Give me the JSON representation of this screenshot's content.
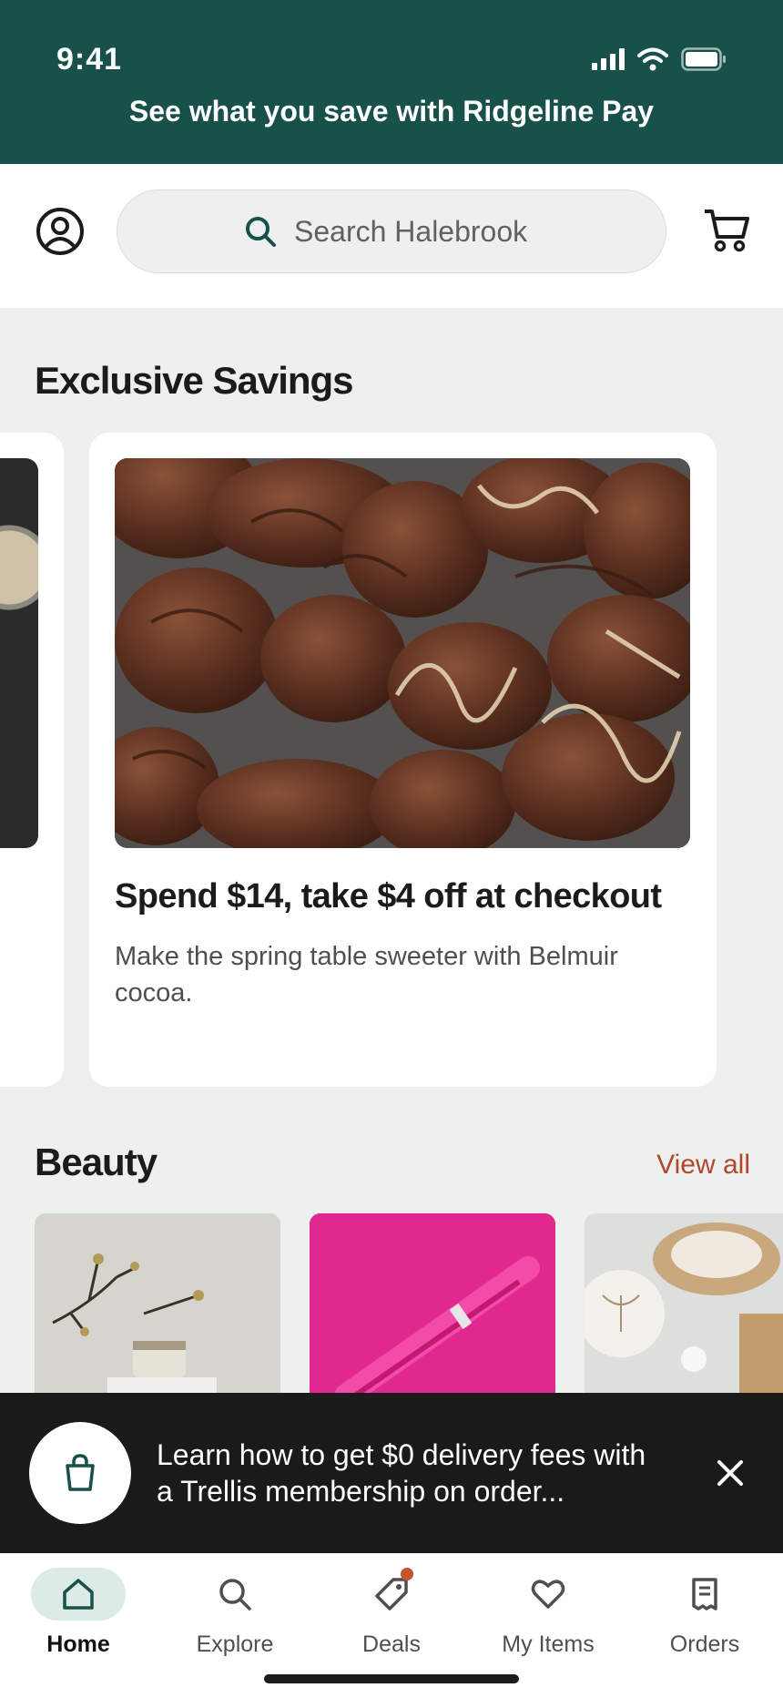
{
  "status_bar": {
    "time": "9:41"
  },
  "promo_banner": {
    "text": "See what you save with Ridgeline Pay"
  },
  "header": {
    "search_placeholder": "Search Halebrook"
  },
  "exclusive_savings": {
    "title": "Exclusive Savings",
    "card": {
      "title": "Spend $14, take $4 off at checkout",
      "description": "Make the spring table sweeter with Belmuir cocoa."
    }
  },
  "beauty": {
    "title": "Beauty",
    "view_all": "View all"
  },
  "membership_banner": {
    "text": "Learn how to get $0 delivery fees with a Trellis membership on order..."
  },
  "nav": {
    "items": [
      {
        "label": "Home",
        "icon": "home-icon"
      },
      {
        "label": "Explore",
        "icon": "search-icon"
      },
      {
        "label": "Deals",
        "icon": "tag-icon"
      },
      {
        "label": "My Items",
        "icon": "heart-icon"
      },
      {
        "label": "Orders",
        "icon": "receipt-icon"
      }
    ]
  },
  "colors": {
    "brand": "#17514a",
    "accent": "#b3472a",
    "nav_active_bg": "#dcebe5"
  }
}
